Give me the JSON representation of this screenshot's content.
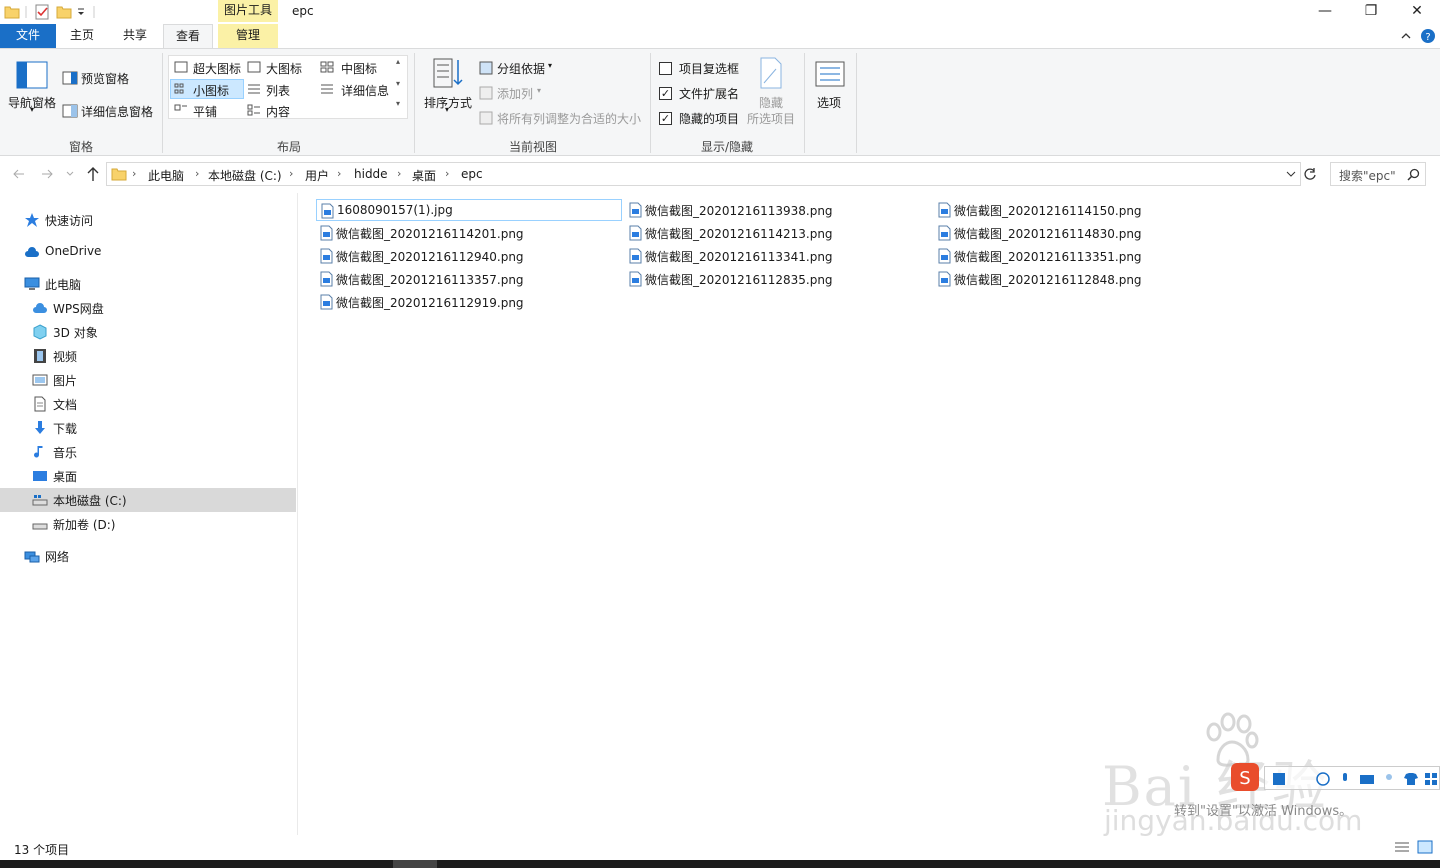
{
  "titlebar": {
    "context_tab": "图片工具",
    "title": "epc",
    "minimize": "—",
    "maximize": "❐",
    "close": "✕"
  },
  "tabs": {
    "file": "文件",
    "home": "主页",
    "share": "共享",
    "view": "查看",
    "manage": "管理"
  },
  "ribbon": {
    "panes": {
      "nav_pane": "导航窗格",
      "preview_pane": "预览窗格",
      "details_pane": "详细信息窗格",
      "label": "窗格"
    },
    "layout": {
      "extra_large": "超大图标",
      "large": "大图标",
      "medium": "中图标",
      "small": "小图标",
      "list": "列表",
      "details": "详细信息",
      "tiles": "平铺",
      "content": "内容",
      "label": "布局"
    },
    "current_view": {
      "sort_by": "排序方式",
      "group_by": "分组依据",
      "add_columns": "添加列",
      "size_all": "将所有列调整为合适的大小",
      "label": "当前视图"
    },
    "show_hide": {
      "item_checkboxes": "项目复选框",
      "item_checkboxes_checked": false,
      "file_ext": "文件扩展名",
      "file_ext_checked": true,
      "hidden_items": "隐藏的项目",
      "hidden_items_checked": true,
      "hide_selected_1": "隐藏",
      "hide_selected_2": "所选项目",
      "label": "显示/隐藏"
    },
    "options": "选项"
  },
  "address": {
    "crumbs": [
      "此电脑",
      "本地磁盘 (C:)",
      "用户",
      "hidde",
      "桌面",
      "epc"
    ],
    "search_placeholder": "搜索\"epc\""
  },
  "nav": {
    "quick_access": "快速访问",
    "onedrive": "OneDrive",
    "this_pc": "此电脑",
    "wps": "WPS网盘",
    "objects3d": "3D 对象",
    "videos": "视频",
    "pictures": "图片",
    "documents": "文档",
    "downloads": "下载",
    "music": "音乐",
    "desktop": "桌面",
    "local_c": "本地磁盘 (C:)",
    "new_d": "新加卷 (D:)",
    "network": "网络"
  },
  "files": [
    "1608090157(1).jpg",
    "微信截图_20201216113938.png",
    "微信截图_20201216114150.png",
    "微信截图_20201216114201.png",
    "微信截图_20201216114213.png",
    "微信截图_20201216114830.png",
    "微信截图_20201216112940.png",
    "微信截图_20201216113341.png",
    "微信截图_20201216113351.png",
    "微信截图_20201216113357.png",
    "微信截图_20201216112835.png",
    "微信截图_20201216112848.png",
    "微信截图_20201216112919.png"
  ],
  "status": {
    "count": "13 个项目"
  },
  "watermark": {
    "brand": "Bai 经验",
    "activate": "转到\"设置\"以激活 Windows。",
    "url": "jingyan.baidu.com"
  },
  "colors": {
    "accent": "#1a6fc7",
    "context": "#fbf1a6",
    "selection": "#cce8ff"
  }
}
